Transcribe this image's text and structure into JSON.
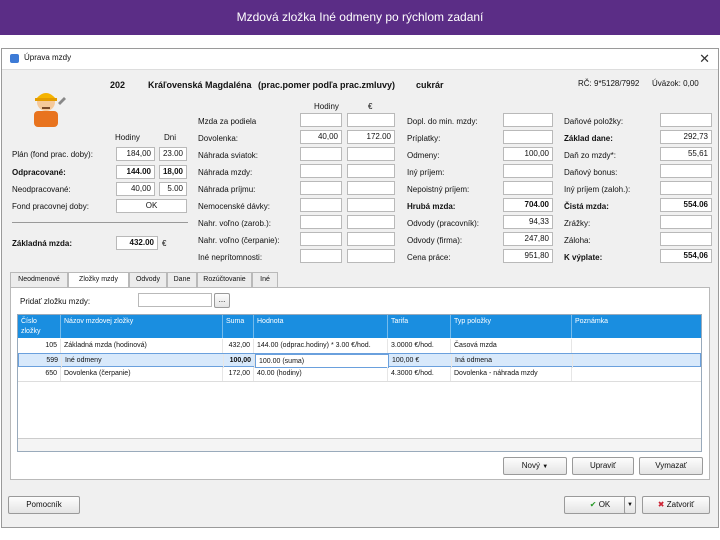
{
  "banner": "Mzdová zložka Iné odmeny po rýchlom zadaní",
  "window": {
    "title": "Úprava mzdy",
    "close": "✕"
  },
  "employee": {
    "number": "202",
    "name": "Kráľovenská Magdaléna",
    "contract": "(prac.pomer podľa prac.zmluvy)",
    "profession": "cukrár",
    "rc": "RČ: 9*5128/7992",
    "dovod": "Úväzok: 0,00"
  },
  "hours": {
    "col_hodiny": "Hodiny",
    "col_dni": "Dni",
    "plan_label": "Plán (fond prac. doby):",
    "plan_h": "184,00",
    "plan_d": "23.00",
    "odp_label": "Odpracované:",
    "odp_h": "144.00",
    "odp_d": "18,00",
    "nep_label": "Neodpracované:",
    "nep_h": "40,00",
    "nep_d": "5.00",
    "fond_label": "Fond pracovnej doby:",
    "fond_btn": "OK",
    "zakl_label": "Základná mzda:",
    "zakl_val": "432.00",
    "zakl_unit": "€"
  },
  "wage": {
    "col_hodiny": "Hodiny",
    "col_eur": "€",
    "mzda_podla": "Mzda za podiela",
    "dovolenka": "Dovolenka:",
    "dov_h": "40,00",
    "dov_eur": "172.00",
    "nahr_sviatok": "Náhrada sviatok:",
    "nahr_mzda": "Náhrada mzdy:",
    "nahr_prijem": "Náhrada príjmu:",
    "nemoc_davky": "Nemocenské dávky:",
    "nahr_volno_zar": "Nahr. voľno (zarob.):",
    "nahr_volno_ucast": "Nahr. voľno (čerpanie):",
    "ine_neprit": "Iné neprítomnosti:"
  },
  "pay": {
    "dopl_min": "Dopl. do min. mzdy:",
    "priplatky": "Príplatky:",
    "odmeny": "Odmeny:",
    "odmeny_val": "100,00",
    "iny_prijem": "Iný príjem:",
    "nepoist_prijem": "Nepoistný príjem:",
    "hruba_mzda": "Hrubá mzda:",
    "hruba_val": "704.00",
    "odv_prac": "Odvody (pracovník):",
    "odv_prac_val": "94,33",
    "odv_firma": "Odvody (firma):",
    "odv_firma_val": "247,80",
    "cena_prace": "Cena práce:",
    "cena_val": "951,80"
  },
  "tax": {
    "danove_polozky": "Daňové položky:",
    "zaklad_dane": "Základ dane:",
    "zaklad_val": "292,73",
    "dan_zo_mzdy": "Daň zo mzdy*:",
    "dan_val": "55,61",
    "danovy_bonus": "Daňový bonus:",
    "iny_prijem_zaloh": "Iný príjem (zaloh.):",
    "cista_mzda": "Čistá mzda:",
    "cista_val": "554.06",
    "zrazky": "Zrážky:",
    "zaloha": "Záloha:",
    "k_vyplate": "K výplate:",
    "kvyp_val": "554,06"
  },
  "tabs": [
    "Neodmenové",
    "Zložky mzdy",
    "Odvody",
    "Dane",
    "Rozúčtovanie",
    "Iné"
  ],
  "panel": {
    "add_label": "Pridať zložku mzdy:",
    "add_btn": "..."
  },
  "grid": {
    "headers": [
      "Číslo zložky",
      "Názov mzdovej zložky",
      "Suma",
      "Hodnota",
      "Tarifa",
      "Typ položky",
      "Poznámka"
    ],
    "rows": [
      {
        "c": "105",
        "name": "Základná mzda (hodinová)",
        "suma": "432,00",
        "hod": "144.00 (odprac.hodiny) * 3.00 €/hod.",
        "tarifa": "3.0000 €/hod.",
        "typ": "Časová mzda",
        "pozn": ""
      },
      {
        "c": "599",
        "name": "Iné odmeny",
        "suma": "100,00",
        "hod": "100.00 (suma)",
        "tarifa": "100,00 €",
        "typ": "Iná odmena",
        "pozn": ""
      },
      {
        "c": "650",
        "name": "Dovolenka (čerpanie)",
        "suma": "172,00",
        "hod": "40.00 (hodiny)",
        "tarifa": "4.3000 €/hod.",
        "typ": "Dovolenka - náhrada mzdy",
        "pozn": ""
      }
    ]
  },
  "buttons": {
    "novy": "Nový",
    "upravit": "Upraviť",
    "vymazat": "Vymazať",
    "pomocnik": "Pomocník",
    "ok": "OK",
    "zatvorit": "Zatvoriť"
  }
}
